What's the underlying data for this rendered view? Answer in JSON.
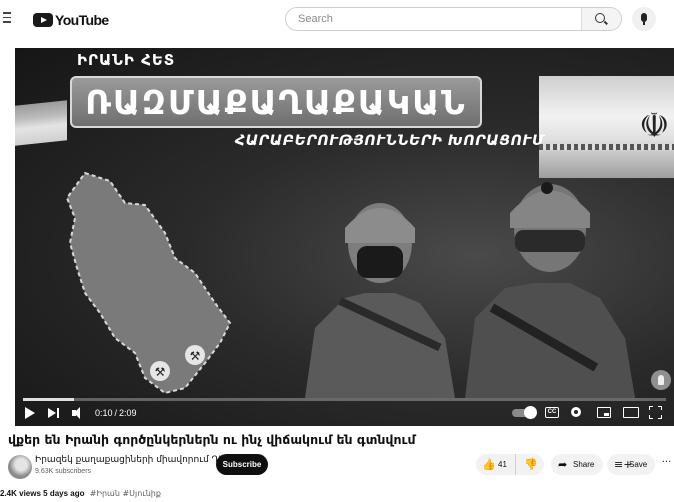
{
  "header": {
    "logo_text": "YouTube",
    "search_placeholder": "Search"
  },
  "player": {
    "overlay": {
      "title_top": "ԻՐԱՆԻ ՀԵՏ",
      "title_main": "ՌԱԶՄԱՔԱՂԱՔԱԿԱՆ",
      "title_sub": "ՀԱՐԱԲԵՐՈՒԹՅՈՒՆՆԵՐԻ ԽՈՐԱՑՈՒՄ"
    },
    "time_current": "0:10",
    "time_separator": "/",
    "time_total": "2:09",
    "progress_fraction": 0.08,
    "cc_label": "CC"
  },
  "video": {
    "title": "վքեր են Իրանի գործընկերներն ու ինչ վիճակում են գտնվում",
    "channel_name": "Իրազեկ քաղաքացիների միավորում ԴԿ",
    "subscribers": "9.63K subscribers",
    "subscribe_label": "Subscribe",
    "like_count": "41",
    "share_label": "Share",
    "save_label": "Save",
    "views": "2.4K views",
    "posted": "5 days ago",
    "hashtags": "#Իրան #Սյունիք"
  },
  "icons": {
    "menu": "menu-icon",
    "search": "search-icon",
    "mic": "mic-icon",
    "like": "thumbs-up-icon",
    "dislike": "thumbs-down-icon",
    "share": "share-arrow-icon",
    "save": "playlist-add-icon",
    "more": "more-horizontal-icon"
  }
}
